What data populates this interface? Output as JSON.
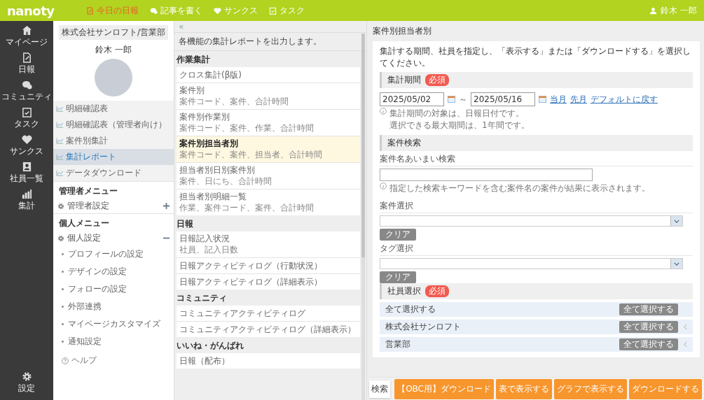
{
  "topbar": {
    "logo": "nanoty",
    "nav": [
      {
        "label": "今日の日報",
        "selected": true
      },
      {
        "label": "記事を書く",
        "selected": false
      },
      {
        "label": "サンクス",
        "selected": false
      },
      {
        "label": "タスク",
        "selected": false
      }
    ],
    "user": "鈴木 一郎"
  },
  "rail": {
    "items": [
      "マイページ",
      "日報",
      "コミュニティ",
      "タスク",
      "サンクス",
      "社員一覧",
      "集計"
    ],
    "settings": "設定"
  },
  "sidebar": {
    "company": "株式会社サンロフト/営業部",
    "name": "鈴木 一郎",
    "menu": [
      {
        "label": "明細確認表",
        "selected": false
      },
      {
        "label": "明細確認表（管理者向け）",
        "selected": false
      },
      {
        "label": "案件別集計",
        "selected": false
      },
      {
        "label": "集計レポート",
        "selected": true
      },
      {
        "label": "データダウンロード",
        "selected": false
      }
    ],
    "admin_heading": "管理者メニュー",
    "admin": {
      "label": "管理者設定",
      "expanded": false
    },
    "personal_heading": "個人メニュー",
    "personal": {
      "label": "個人設定",
      "expanded": true,
      "children": [
        "プロフィールの設定",
        "デザインの設定",
        "フォローの設定",
        "外部連携",
        "マイページカスタマイズ",
        "通知設定"
      ]
    },
    "help": "ヘルプ"
  },
  "reports": {
    "collapse": "«",
    "intro": "各機能の集計レポートを出力します。",
    "sections": [
      {
        "title": "作業集計",
        "items": [
          {
            "title": "クロス集計(β版)",
            "selected": false
          },
          {
            "title": "案件別",
            "sub": "案件コード、案件、合計時間",
            "selected": false
          },
          {
            "title": "案件別作業別",
            "sub": "案件コード、案件、作業、合計時間",
            "selected": false
          },
          {
            "title": "案件別担当者別",
            "sub": "案件コード、案件、担当者、合計時間",
            "selected": true
          },
          {
            "title": "担当者別日別案件別",
            "sub": "案件、日にち、合計時間",
            "selected": false
          },
          {
            "title": "担当者別明細一覧",
            "sub": "作業、案件コード、案件、合計時間",
            "selected": false
          }
        ]
      },
      {
        "title": "日報",
        "items": [
          {
            "title": "日報記入状況",
            "sub": "社員、記入日数",
            "selected": false
          },
          {
            "title": "日報アクティビティログ（行動状況）",
            "selected": false
          },
          {
            "title": "日報アクティビティログ（詳細表示）",
            "selected": false
          }
        ]
      },
      {
        "title": "コミュニティ",
        "items": [
          {
            "title": "コミュニティアクティビティログ",
            "selected": false
          },
          {
            "title": "コミュニティアクティビティログ（詳細表示）",
            "selected": false
          }
        ]
      },
      {
        "title": "いいね・がんばれ",
        "items": [
          {
            "title": "日報（配布）",
            "selected": false
          }
        ]
      }
    ]
  },
  "main": {
    "title": "案件別担当者別",
    "intro": "集計する期間、社員を指定し、「表示する」または「ダウンロードする」を選択してください。",
    "period": {
      "heading": "集計期間",
      "badge": "必須",
      "from": "2025/05/02",
      "tilde": "～",
      "to": "2025/05/16",
      "links": [
        "当月",
        "先月",
        "デフォルトに戻す"
      ],
      "notes": [
        "集計期間の対象は、日報日付です。",
        "選択できる最大期間は、1年間です。"
      ]
    },
    "search": {
      "heading": "案件検索",
      "fuzzy_label": "案件名あいまい検索",
      "fuzzy_note": "指定した検索キーワードを含む案件名の案件が結果に表示されます。",
      "selects": [
        {
          "label": "案件選択",
          "clear": "クリア"
        },
        {
          "label": "タグ選択",
          "clear": "クリア"
        }
      ]
    },
    "staff": {
      "heading": "社員選択",
      "badge": "必須",
      "rows": [
        {
          "label": "全て選択する",
          "button": "全て選択する",
          "kind": "all"
        },
        {
          "label": "株式会社サンロフト",
          "button": "全て選択する",
          "kind": "group"
        },
        {
          "label": "営業部",
          "button": "全て選択する",
          "kind": "group"
        }
      ]
    }
  },
  "footer": {
    "search_tab": "検索",
    "buttons": [
      "【OBC用】ダウンロード",
      "表で表示する",
      "グラフで表示する",
      "ダウンロードする"
    ]
  }
}
